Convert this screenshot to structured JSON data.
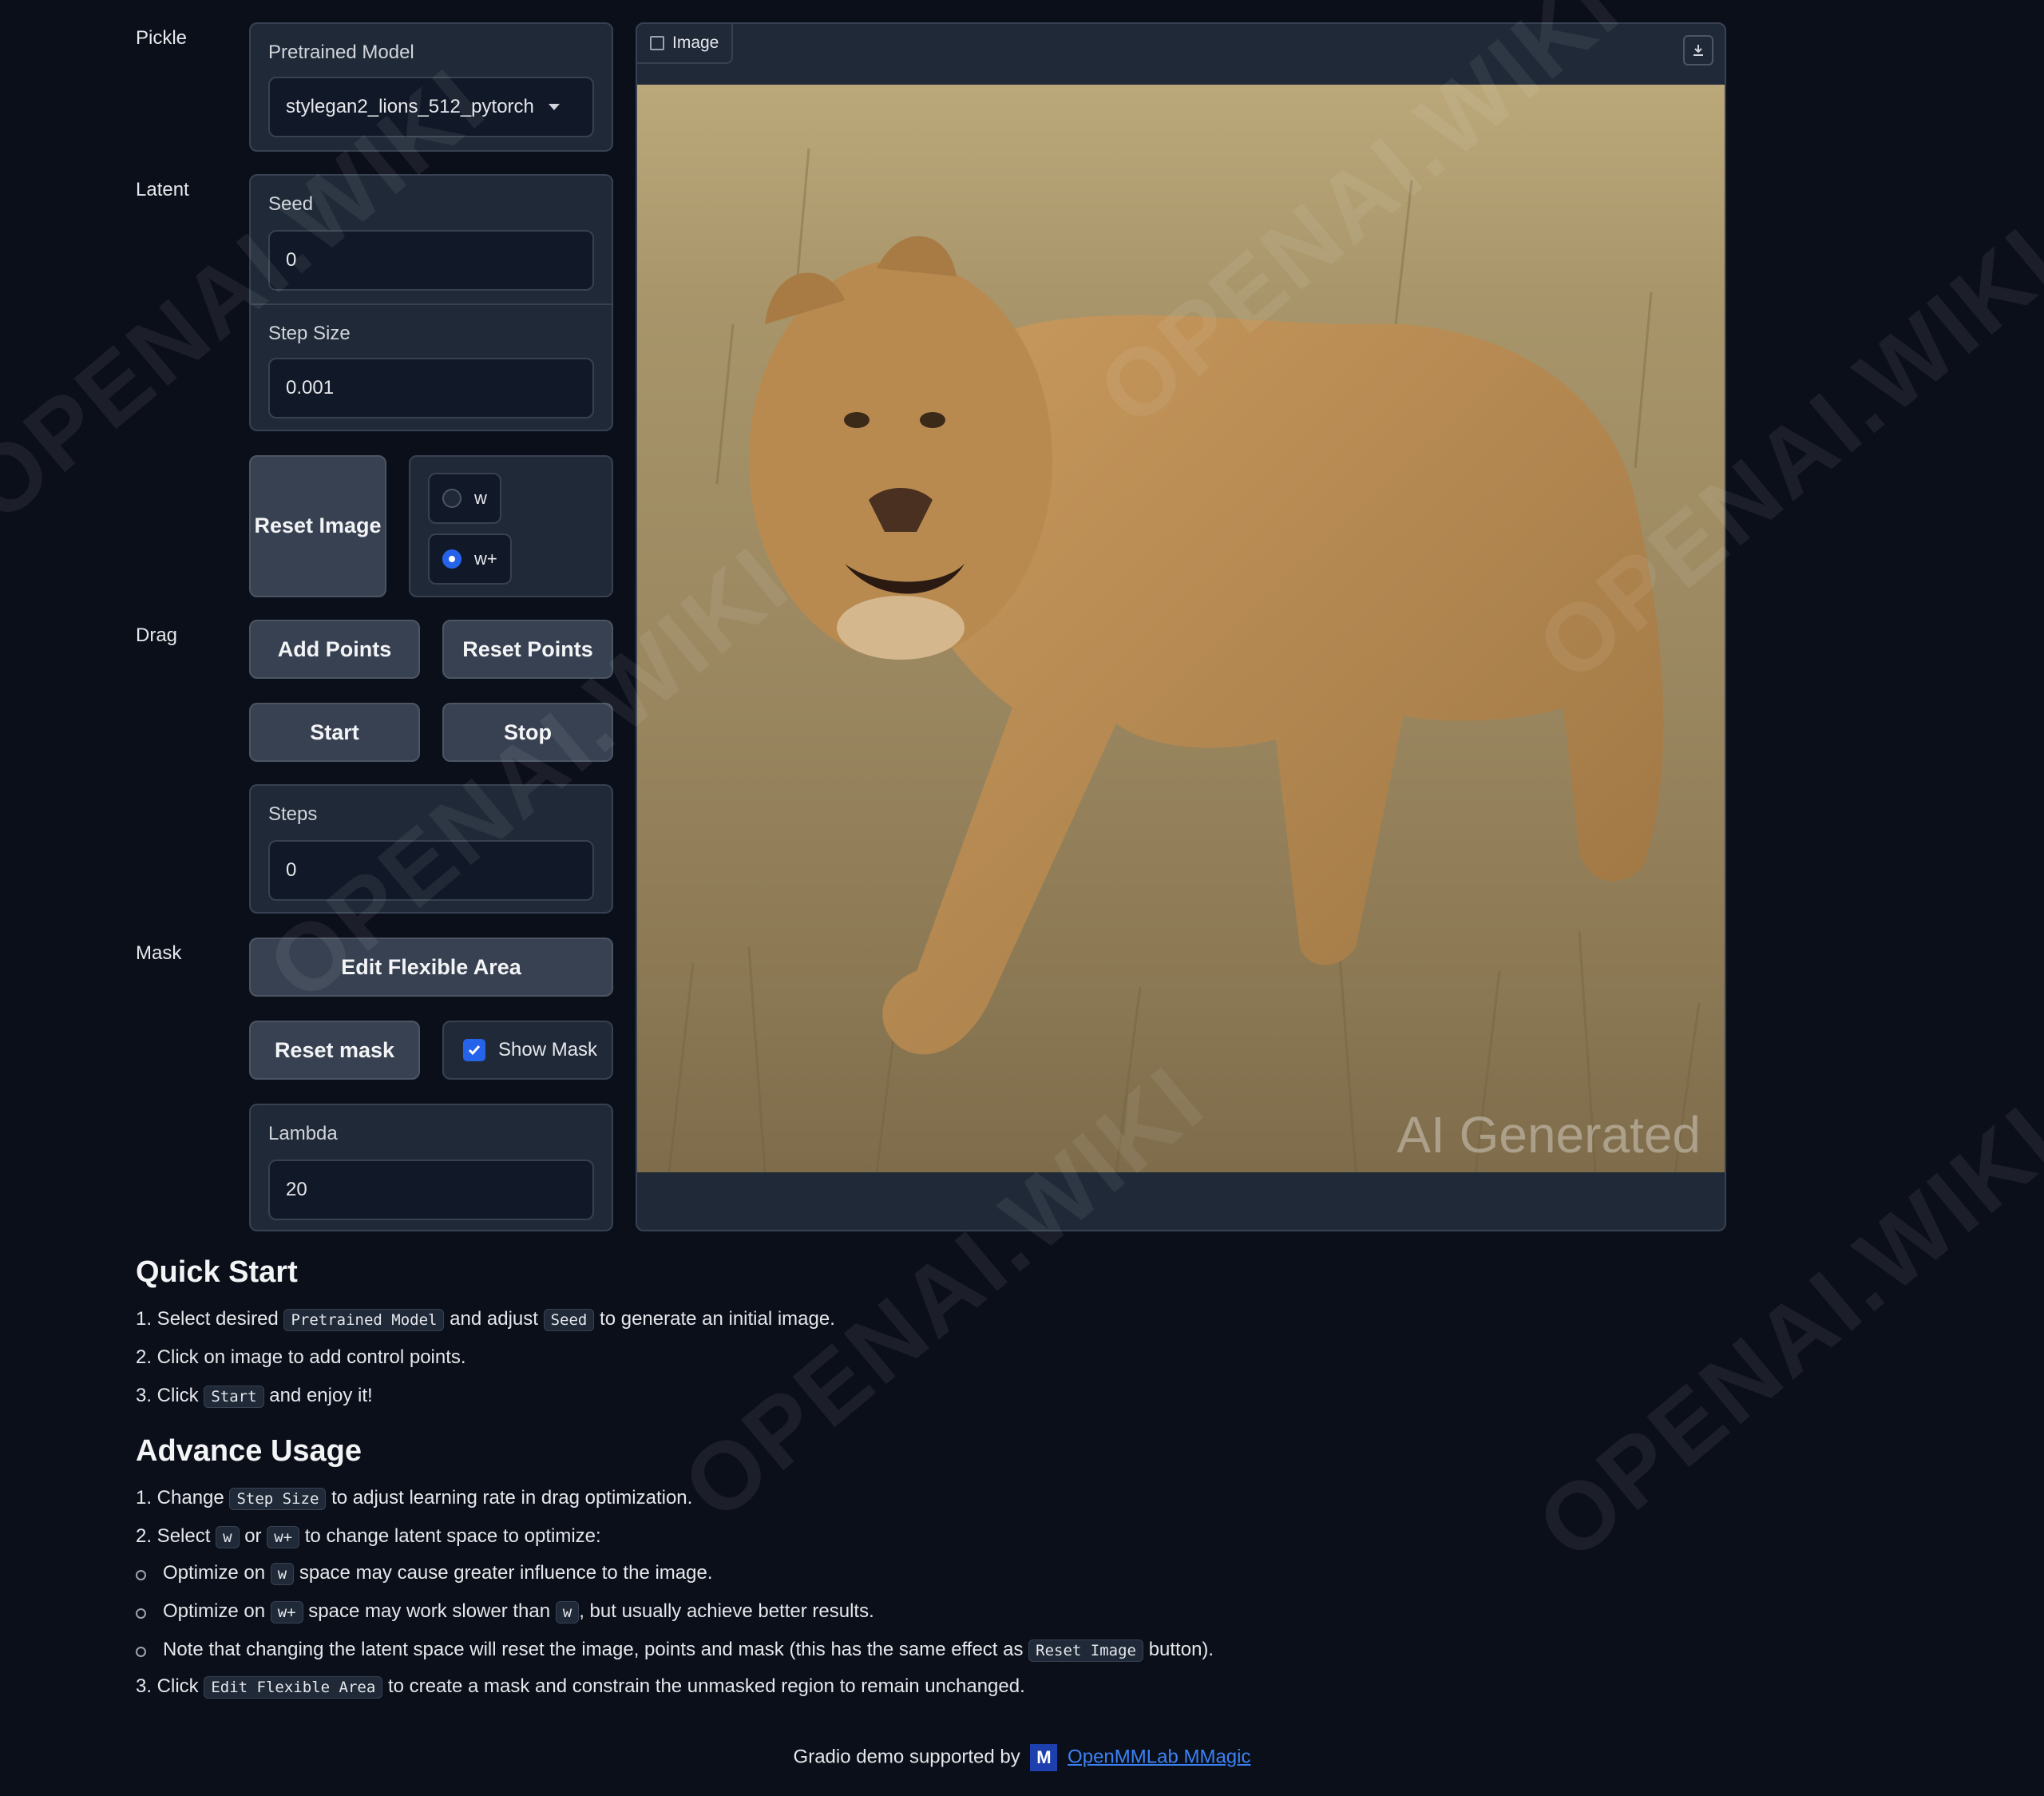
{
  "sections": {
    "pickle": "Pickle",
    "latent": "Latent",
    "drag": "Drag",
    "mask": "Mask"
  },
  "pretrained_model": {
    "label": "Pretrained Model",
    "value": "stylegan2_lions_512_pytorch"
  },
  "seed": {
    "label": "Seed",
    "value": "0"
  },
  "step_size": {
    "label": "Step Size",
    "value": "0.001"
  },
  "reset_image_label": "Reset Image",
  "latent_space": {
    "options": [
      "w",
      "w+"
    ],
    "selected": "w+"
  },
  "buttons": {
    "add_points": "Add Points",
    "reset_points": "Reset Points",
    "start": "Start",
    "stop": "Stop",
    "edit_flexible_area": "Edit Flexible Area",
    "reset_mask": "Reset mask"
  },
  "steps": {
    "label": "Steps",
    "value": "0"
  },
  "show_mask": {
    "label": "Show Mask",
    "checked": true
  },
  "lambda": {
    "label": "Lambda",
    "value": "20"
  },
  "image_panel": {
    "tab_label": "Image",
    "overlay_text": "AI Generated"
  },
  "quick_start": {
    "title": "Quick Start",
    "step1": {
      "num": "1. Select desired",
      "code1": "Pretrained Model",
      "mid": "and adjust",
      "code2": "Seed",
      "end": "to generate an initial image."
    },
    "step2": "2. Click on image to add control points.",
    "step3": {
      "num": "3. Click",
      "code": "Start",
      "end": "and enjoy it!"
    }
  },
  "advance_usage": {
    "title": "Advance Usage",
    "step1": {
      "num": "1. Change",
      "code": "Step Size",
      "end": "to adjust learning rate in drag optimization."
    },
    "step2": {
      "num": "2. Select",
      "code1": "w",
      "mid": "or",
      "code2": "w+",
      "end": "to change latent space to optimize:"
    },
    "bullet1": {
      "pre": "Optimize on",
      "code": "w",
      "end": "space may cause greater influence to the image."
    },
    "bullet2": {
      "pre": "Optimize on",
      "code1": "w+",
      "mid": "space may work slower than",
      "code2": "w",
      "end": ", but usually achieve better results."
    },
    "bullet3": {
      "pre": "Note that changing the latent space will reset the image, points and mask (this has the same effect as",
      "code": "Reset Image",
      "end": "button)."
    },
    "step3": {
      "num": "3. Click",
      "code": "Edit Flexible Area",
      "end": "to create a mask and constrain the unmasked region to remain unchanged."
    }
  },
  "footer": {
    "text": "Gradio demo supported by",
    "link": "OpenMMLab MMagic"
  },
  "watermark_text": "OPENAI.WIKI",
  "colors": {
    "background": "#0b0f19",
    "panel": "#1f2937",
    "accent": "#2563eb",
    "link": "#3b82f6"
  }
}
